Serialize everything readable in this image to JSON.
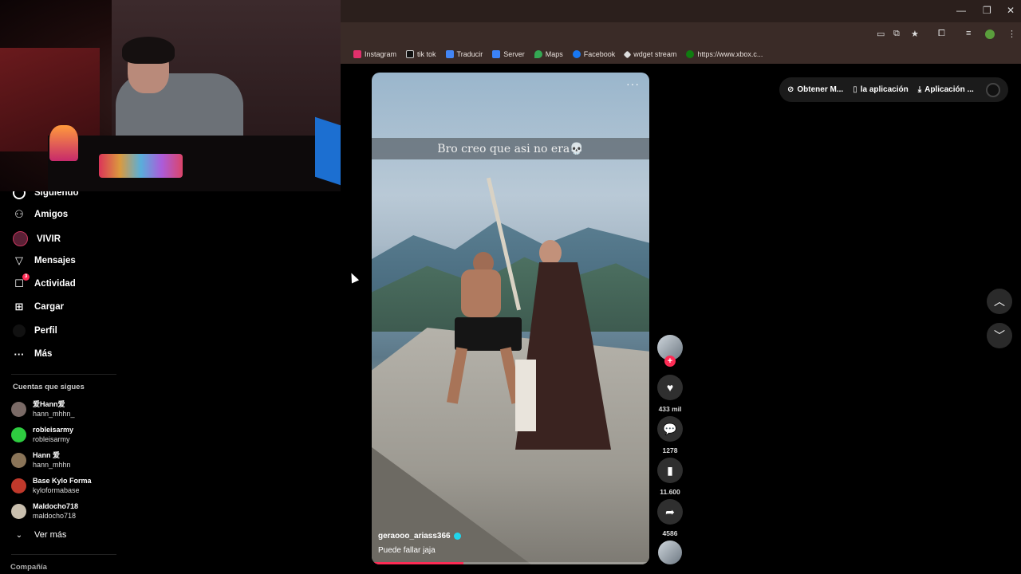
{
  "browser": {
    "bookmarks": [
      {
        "label": "Instagram",
        "icon": "instagram-icon",
        "color": "#e1306c"
      },
      {
        "label": "tik tok",
        "icon": "tiktok-icon",
        "color": "#ffffff"
      },
      {
        "label": "Traducir",
        "icon": "translate-icon",
        "color": "#4285f4"
      },
      {
        "label": "Server",
        "icon": "server-icon",
        "color": "#3b82f6"
      },
      {
        "label": "Maps",
        "icon": "maps-icon",
        "color": "#34a853"
      },
      {
        "label": "Facebook",
        "icon": "facebook-icon",
        "color": "#1877f2"
      },
      {
        "label": "wdget stream",
        "icon": "widget-icon",
        "color": "#dddddd"
      },
      {
        "label": "https://www.xbox.c...",
        "icon": "xbox-icon",
        "color": "#107c10"
      }
    ]
  },
  "sidebar": {
    "items": [
      {
        "label": "Siguiendo",
        "icon": "following-icon"
      },
      {
        "label": "Amigos",
        "icon": "friends-icon"
      },
      {
        "label": "VIVIR",
        "icon": "live-icon"
      },
      {
        "label": "Mensajes",
        "icon": "messages-icon"
      },
      {
        "label": "Actividad",
        "icon": "activity-icon",
        "badge": "3"
      },
      {
        "label": "Cargar",
        "icon": "upload-icon"
      },
      {
        "label": "Perfil",
        "icon": "profile-icon"
      },
      {
        "label": "Más",
        "icon": "more-icon"
      }
    ],
    "following_title": "Cuentas que sigues",
    "accounts": [
      {
        "name": "爱Hann爱",
        "handle": "hann_mhhn_",
        "color": "#7a6a66"
      },
      {
        "name": "robleisarmy",
        "handle": "robleisarmy",
        "color": "#2ecc40"
      },
      {
        "name": "Hann 爱",
        "handle": "hann_mhhn",
        "color": "#8a7458"
      },
      {
        "name": "Base Kylo Forma",
        "handle": "kyloformabase",
        "color": "#c0392b"
      },
      {
        "name": "Maldocho718",
        "handle": "maldocho718",
        "color": "#c9bfae"
      }
    ],
    "see_more": "Ver más",
    "company": "Compañía"
  },
  "video": {
    "caption": "Bro creo que asi no era💀",
    "author": "geraooo_ariass366",
    "description": "Puede fallar jaja",
    "progress": 0.33
  },
  "actions": {
    "likes": "433 mil",
    "comments": "1278",
    "saves": "11.600",
    "shares": "4586"
  },
  "top_pill": {
    "item1": "Obtener M...",
    "item2": "la aplicación",
    "item3": "Aplicación ..."
  }
}
